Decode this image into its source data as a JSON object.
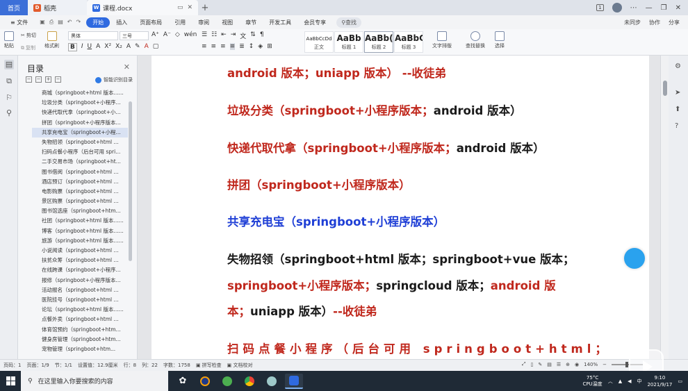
{
  "titlebar": {
    "home_tab": "首页",
    "docer_tab": "稻壳",
    "doc_tab": "课程.docx",
    "new_tab_icon": "plus-icon"
  },
  "menubar": {
    "file": "文件",
    "items": [
      "开始",
      "插入",
      "页面布局",
      "引用",
      "审阅",
      "视图",
      "章节",
      "开发工具",
      "会员专享"
    ],
    "search": "查找",
    "right": [
      "未同步",
      "协作",
      "分享"
    ]
  },
  "ribbon": {
    "paste": "粘贴",
    "cut": "剪切",
    "copy": "复制",
    "format_painter": "格式刷",
    "font_name": "黑体",
    "font_size": "三号",
    "styles": [
      {
        "sample": "AaBbCcDd",
        "label": "正文"
      },
      {
        "sample": "AaBb",
        "label": "标题 1"
      },
      {
        "sample": "AaBb(",
        "label": "标题 2"
      },
      {
        "sample": "AaBbC",
        "label": "标题 3"
      }
    ],
    "text_layout": "文字排版",
    "find_replace": "查找替换",
    "select": "选择"
  },
  "toc": {
    "title": "目录",
    "smart": "智能识别目录",
    "items": [
      "商城（springboot+html 版本......",
      "垃圾分类（springboot+小程序...",
      "快递代取代拿（springboot+小...",
      "拼团（springboot+小程序版本...",
      "共享充电宝（springboot+小程...",
      "失物招领（springboot+html ...",
      "扫码点餐小程序（后台可用 spri...",
      "二手交易市场（springboot+ht...",
      "图书借阅（springboot+html ...",
      "酒店预订（springboot+html ...",
      "电影购票（springboot+html ...",
      "景区购票（springboot+html ...",
      "图书馆选座（springboot+htm...",
      "社团（springboot+html 版本......",
      "博客（springboot+html 版本......",
      "旅游（springboot+html 版本......",
      "小说阅读（springboot+html ...",
      "扶贫众筹（springboot+html ...",
      "在线跨课（springboot+小程序...",
      "报修（springboot+小程序版本...",
      "活动报名（springboot+html ...",
      "医院挂号（springboot+html ...",
      "论坛（springboot+html 版本......",
      "点餐外卖（springboot+html ...",
      "体育馆预约（springboot+htm...",
      "健身房管理（springboot+htm...",
      "宠物管理（springboot+htm..."
    ]
  },
  "document": {
    "line1_red": "android 版本；uniapp 版本） --收徒弟",
    "line2_red": "垃圾分类（springboot+小程序版本；",
    "line2_blk": "android 版本）",
    "line3_red": "快递代取代拿（springboot+小程序版本；",
    "line3_blk": "android 版本）",
    "line4_red": "拼团（springboot+小程序版本）",
    "line5_blu": "共享充电宝（springboot+小程序版本）",
    "line6_blk": "失物招领（springboot+html 版本；springboot+vue 版本；",
    "line7_red_a": "springboot+小程序版本；",
    "line7_blk": "springcloud 版本；",
    "line7_red_b": "android 版",
    "line8_red_a": "本；",
    "line8_blk": "uniapp 版本）",
    "line8_red_b": "--收徒弟",
    "line9_red": "扫码点餐小程序（后台可用 springboot+html；"
  },
  "statusbar": {
    "page": "页码：1",
    "pages": "页面：1/9",
    "section": "节：1/1",
    "setting": "设置值：12.9厘米",
    "row": "行：8",
    "col": "列：22",
    "words": "字数：1758",
    "spellcheck": "拼写检查",
    "proofread": "文档校对",
    "zoom": "140%"
  },
  "taskbar": {
    "search_placeholder": "在这里输入你要搜索的内容",
    "temp": "75°C",
    "temp_label": "CPU温度",
    "ime": "中",
    "time": "9:10",
    "date": "2021/9/17"
  }
}
